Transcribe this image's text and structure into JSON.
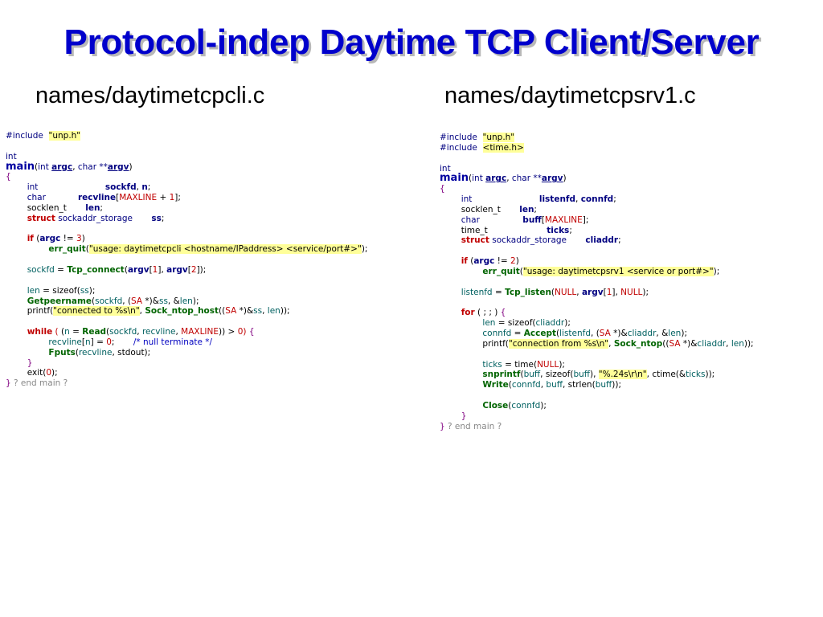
{
  "title": "Protocol-indep Daytime TCP Client/Server",
  "left": {
    "filename": "names/daytimetcpcli.c",
    "lines": [
      [
        [
          "pre",
          "#include  "
        ],
        [
          "str",
          "\"unp.h\""
        ]
      ],
      [],
      [
        [
          "type",
          "int"
        ]
      ],
      [
        [
          "fname",
          "main"
        ],
        [
          "plain",
          "("
        ],
        [
          "type",
          "int "
        ],
        [
          "param",
          "argc"
        ],
        [
          "plain",
          ", "
        ],
        [
          "type",
          "char **"
        ],
        [
          "param",
          "argv"
        ],
        [
          "plain",
          ")"
        ]
      ],
      [
        [
          "brace",
          "{"
        ]
      ],
      [
        [
          "plain",
          "        "
        ],
        [
          "type",
          "int"
        ],
        [
          "plain",
          "                         "
        ],
        [
          "var",
          "sockfd"
        ],
        [
          "plain",
          ", "
        ],
        [
          "var",
          "n"
        ],
        [
          "plain",
          ";"
        ]
      ],
      [
        [
          "plain",
          "        "
        ],
        [
          "type",
          "char"
        ],
        [
          "plain",
          "            "
        ],
        [
          "var",
          "recvline"
        ],
        [
          "plain",
          "["
        ],
        [
          "macro",
          "MAXLINE"
        ],
        [
          "plain",
          " + "
        ],
        [
          "num",
          "1"
        ],
        [
          "plain",
          "];"
        ]
      ],
      [
        [
          "plain",
          "        "
        ],
        [
          "plain",
          "socklen_t       "
        ],
        [
          "var",
          "len"
        ],
        [
          "plain",
          ";"
        ]
      ],
      [
        [
          "plain",
          "        "
        ],
        [
          "kw",
          "struct"
        ],
        [
          "plain",
          " "
        ],
        [
          "type",
          "sockaddr_storage"
        ],
        [
          "plain",
          "       "
        ],
        [
          "var",
          "ss"
        ],
        [
          "plain",
          ";"
        ]
      ],
      [],
      [
        [
          "plain",
          "        "
        ],
        [
          "kw",
          "if"
        ],
        [
          "plain",
          " ("
        ],
        [
          "var",
          "argc"
        ],
        [
          "plain",
          " != "
        ],
        [
          "num",
          "3"
        ],
        [
          "plain",
          ")"
        ]
      ],
      [
        [
          "plain",
          "                "
        ],
        [
          "func",
          "err_quit"
        ],
        [
          "plain",
          "("
        ],
        [
          "str",
          "\"usage: daytimetcpcli <hostname/IPaddress> <service/port#>\""
        ],
        [
          "plain",
          ");"
        ]
      ],
      [],
      [
        [
          "plain",
          "        "
        ],
        [
          "local",
          "sockfd"
        ],
        [
          "plain",
          " = "
        ],
        [
          "func",
          "Tcp_connect"
        ],
        [
          "plain",
          "("
        ],
        [
          "var",
          "argv"
        ],
        [
          "plain",
          "["
        ],
        [
          "num",
          "1"
        ],
        [
          "plain",
          "], "
        ],
        [
          "var",
          "argv"
        ],
        [
          "plain",
          "["
        ],
        [
          "num",
          "2"
        ],
        [
          "plain",
          "]);"
        ]
      ],
      [],
      [
        [
          "plain",
          "        "
        ],
        [
          "local",
          "len"
        ],
        [
          "plain",
          " = sizeof("
        ],
        [
          "local",
          "ss"
        ],
        [
          "plain",
          ");"
        ]
      ],
      [
        [
          "plain",
          "        "
        ],
        [
          "func",
          "Getpeername"
        ],
        [
          "plain",
          "("
        ],
        [
          "local",
          "sockfd"
        ],
        [
          "plain",
          ", ("
        ],
        [
          "macro",
          "SA"
        ],
        [
          "plain",
          " *)&"
        ],
        [
          "local",
          "ss"
        ],
        [
          "plain",
          ", &"
        ],
        [
          "local",
          "len"
        ],
        [
          "plain",
          ");"
        ]
      ],
      [
        [
          "plain",
          "        printf("
        ],
        [
          "str",
          "\"connected to %s\\n\""
        ],
        [
          "plain",
          ", "
        ],
        [
          "func",
          "Sock_ntop_host"
        ],
        [
          "plain",
          "(("
        ],
        [
          "macro",
          "SA"
        ],
        [
          "plain",
          " *)&"
        ],
        [
          "local",
          "ss"
        ],
        [
          "plain",
          ", "
        ],
        [
          "local",
          "len"
        ],
        [
          "plain",
          "));"
        ]
      ],
      [],
      [
        [
          "plain",
          "        "
        ],
        [
          "kw",
          "while"
        ],
        [
          "plain",
          " "
        ],
        [
          "paren",
          "("
        ],
        [
          "plain",
          " ("
        ],
        [
          "local",
          "n"
        ],
        [
          "plain",
          " = "
        ],
        [
          "func",
          "Read"
        ],
        [
          "plain",
          "("
        ],
        [
          "local",
          "sockfd"
        ],
        [
          "plain",
          ", "
        ],
        [
          "local",
          "recvline"
        ],
        [
          "plain",
          ", "
        ],
        [
          "macro",
          "MAXLINE"
        ],
        [
          "plain",
          ")) > "
        ],
        [
          "num",
          "0"
        ],
        [
          "paren",
          ")"
        ],
        [
          "plain",
          " "
        ],
        [
          "brace",
          "{"
        ]
      ],
      [
        [
          "plain",
          "                "
        ],
        [
          "local",
          "recvline"
        ],
        [
          "plain",
          "["
        ],
        [
          "local",
          "n"
        ],
        [
          "plain",
          "] = "
        ],
        [
          "num",
          "0"
        ],
        [
          "plain",
          ";       "
        ],
        [
          "comment",
          "/* null terminate */"
        ]
      ],
      [
        [
          "plain",
          "                "
        ],
        [
          "func",
          "Fputs"
        ],
        [
          "plain",
          "("
        ],
        [
          "local",
          "recvline"
        ],
        [
          "plain",
          ", stdout);"
        ]
      ],
      [
        [
          "plain",
          "        "
        ],
        [
          "brace",
          "}"
        ]
      ],
      [
        [
          "plain",
          "        exit("
        ],
        [
          "num",
          "0"
        ],
        [
          "plain",
          ");"
        ]
      ],
      [
        [
          "brace",
          "}"
        ],
        [
          "endcmt",
          " ? end main ?"
        ]
      ]
    ]
  },
  "right": {
    "filename": "names/daytimetcpsrv1.c",
    "lines": [
      [
        [
          "pre",
          "#include  "
        ],
        [
          "str",
          "\"unp.h\""
        ]
      ],
      [
        [
          "pre",
          "#include  "
        ],
        [
          "str",
          "<time.h>"
        ]
      ],
      [],
      [
        [
          "type",
          "int"
        ]
      ],
      [
        [
          "fname",
          "main"
        ],
        [
          "plain",
          "("
        ],
        [
          "type",
          "int "
        ],
        [
          "param",
          "argc"
        ],
        [
          "plain",
          ", "
        ],
        [
          "type",
          "char **"
        ],
        [
          "param",
          "argv"
        ],
        [
          "plain",
          ")"
        ]
      ],
      [
        [
          "brace",
          "{"
        ]
      ],
      [
        [
          "plain",
          "        "
        ],
        [
          "type",
          "int"
        ],
        [
          "plain",
          "                         "
        ],
        [
          "var",
          "listenfd"
        ],
        [
          "plain",
          ", "
        ],
        [
          "var",
          "connfd"
        ],
        [
          "plain",
          ";"
        ]
      ],
      [
        [
          "plain",
          "        "
        ],
        [
          "plain",
          "socklen_t       "
        ],
        [
          "var",
          "len"
        ],
        [
          "plain",
          ";"
        ]
      ],
      [
        [
          "plain",
          "        "
        ],
        [
          "type",
          "char"
        ],
        [
          "plain",
          "                "
        ],
        [
          "var",
          "buff"
        ],
        [
          "plain",
          "["
        ],
        [
          "macro",
          "MAXLINE"
        ],
        [
          "plain",
          "];"
        ]
      ],
      [
        [
          "plain",
          "        "
        ],
        [
          "plain",
          "time_t                      "
        ],
        [
          "var",
          "ticks"
        ],
        [
          "plain",
          ";"
        ]
      ],
      [
        [
          "plain",
          "        "
        ],
        [
          "kw",
          "struct"
        ],
        [
          "plain",
          " "
        ],
        [
          "type",
          "sockaddr_storage"
        ],
        [
          "plain",
          "       "
        ],
        [
          "var",
          "cliaddr"
        ],
        [
          "plain",
          ";"
        ]
      ],
      [],
      [
        [
          "plain",
          "        "
        ],
        [
          "kw",
          "if"
        ],
        [
          "plain",
          " ("
        ],
        [
          "var",
          "argc"
        ],
        [
          "plain",
          " != "
        ],
        [
          "num",
          "2"
        ],
        [
          "plain",
          ")"
        ]
      ],
      [
        [
          "plain",
          "                "
        ],
        [
          "func",
          "err_quit"
        ],
        [
          "plain",
          "("
        ],
        [
          "str",
          "\"usage: daytimetcpsrv1 <service or port#>\""
        ],
        [
          "plain",
          ");"
        ]
      ],
      [],
      [
        [
          "plain",
          "        "
        ],
        [
          "local",
          "listenfd"
        ],
        [
          "plain",
          " = "
        ],
        [
          "func",
          "Tcp_listen"
        ],
        [
          "plain",
          "("
        ],
        [
          "macro",
          "NULL"
        ],
        [
          "plain",
          ", "
        ],
        [
          "var",
          "argv"
        ],
        [
          "plain",
          "["
        ],
        [
          "num",
          "1"
        ],
        [
          "plain",
          "], "
        ],
        [
          "macro",
          "NULL"
        ],
        [
          "plain",
          ");"
        ]
      ],
      [],
      [
        [
          "plain",
          "        "
        ],
        [
          "kw",
          "for"
        ],
        [
          "plain",
          " ( ; ; ) "
        ],
        [
          "brace",
          "{"
        ]
      ],
      [
        [
          "plain",
          "                "
        ],
        [
          "local",
          "len"
        ],
        [
          "plain",
          " = sizeof("
        ],
        [
          "local",
          "cliaddr"
        ],
        [
          "plain",
          ");"
        ]
      ],
      [
        [
          "plain",
          "                "
        ],
        [
          "local",
          "connfd"
        ],
        [
          "plain",
          " = "
        ],
        [
          "func",
          "Accept"
        ],
        [
          "plain",
          "("
        ],
        [
          "local",
          "listenfd"
        ],
        [
          "plain",
          ", ("
        ],
        [
          "macro",
          "SA"
        ],
        [
          "plain",
          " *)&"
        ],
        [
          "local",
          "cliaddr"
        ],
        [
          "plain",
          ", &"
        ],
        [
          "local",
          "len"
        ],
        [
          "plain",
          ");"
        ]
      ],
      [
        [
          "plain",
          "                printf("
        ],
        [
          "str",
          "\"connection from %s\\n\""
        ],
        [
          "plain",
          ", "
        ],
        [
          "func",
          "Sock_ntop"
        ],
        [
          "plain",
          "(("
        ],
        [
          "macro",
          "SA"
        ],
        [
          "plain",
          " *)&"
        ],
        [
          "local",
          "cliaddr"
        ],
        [
          "plain",
          ", "
        ],
        [
          "local",
          "len"
        ],
        [
          "plain",
          "));"
        ]
      ],
      [],
      [
        [
          "plain",
          "                "
        ],
        [
          "local",
          "ticks"
        ],
        [
          "plain",
          " = time("
        ],
        [
          "macro",
          "NULL"
        ],
        [
          "plain",
          ");"
        ]
      ],
      [
        [
          "plain",
          "                "
        ],
        [
          "func",
          "snprintf"
        ],
        [
          "plain",
          "("
        ],
        [
          "local",
          "buff"
        ],
        [
          "plain",
          ", sizeof("
        ],
        [
          "local",
          "buff"
        ],
        [
          "plain",
          "), "
        ],
        [
          "str",
          "\"%.24s\\r\\n\""
        ],
        [
          "plain",
          ", ctime(&"
        ],
        [
          "local",
          "ticks"
        ],
        [
          "plain",
          "));"
        ]
      ],
      [
        [
          "plain",
          "                "
        ],
        [
          "func",
          "Write"
        ],
        [
          "plain",
          "("
        ],
        [
          "local",
          "connfd"
        ],
        [
          "plain",
          ", "
        ],
        [
          "local",
          "buff"
        ],
        [
          "plain",
          ", strlen("
        ],
        [
          "local",
          "buff"
        ],
        [
          "plain",
          "));"
        ]
      ],
      [],
      [
        [
          "plain",
          "                "
        ],
        [
          "func",
          "Close"
        ],
        [
          "plain",
          "("
        ],
        [
          "local",
          "connfd"
        ],
        [
          "plain",
          ");"
        ]
      ],
      [
        [
          "plain",
          "        "
        ],
        [
          "brace",
          "}"
        ]
      ],
      [
        [
          "brace",
          "}"
        ],
        [
          "endcmt",
          " ? end main ?"
        ]
      ]
    ]
  }
}
